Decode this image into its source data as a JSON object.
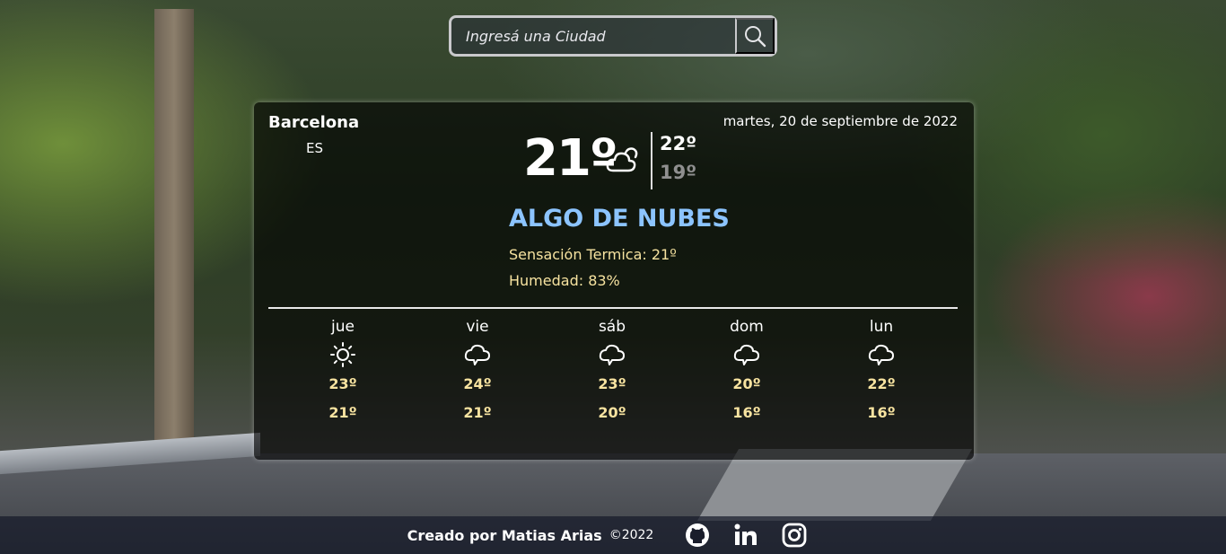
{
  "search": {
    "placeholder": "Ingresá una Ciudad"
  },
  "current": {
    "city": "Barcelona",
    "country": "ES",
    "date": "martes, 20 de septiembre de 2022",
    "temp": "21º",
    "max": "22º",
    "min": "19º",
    "description": "ALGO DE NUBES",
    "feels_like": "Sensación Termica: 21º",
    "humidity": "Humedad: 83%",
    "icon": "partly-cloudy-icon"
  },
  "forecast": [
    {
      "day": "jue",
      "max": "23º",
      "min": "21º",
      "icon": "sun-icon"
    },
    {
      "day": "vie",
      "max": "24º",
      "min": "21º",
      "icon": "cloud-icon"
    },
    {
      "day": "sáb",
      "max": "23º",
      "min": "20º",
      "icon": "cloud-icon"
    },
    {
      "day": "dom",
      "max": "20º",
      "min": "16º",
      "icon": "cloud-icon"
    },
    {
      "day": "lun",
      "max": "22º",
      "min": "16º",
      "icon": "cloud-icon"
    }
  ],
  "footer": {
    "credit": "Creado por Matias Arias",
    "year": "©2022",
    "links": [
      "github-icon",
      "linkedin-icon",
      "instagram-icon"
    ]
  },
  "colors": {
    "description": "#8cc4ff",
    "accent_yellow": "#f7e3a0",
    "min_temp_gray": "#8f8f8f"
  }
}
